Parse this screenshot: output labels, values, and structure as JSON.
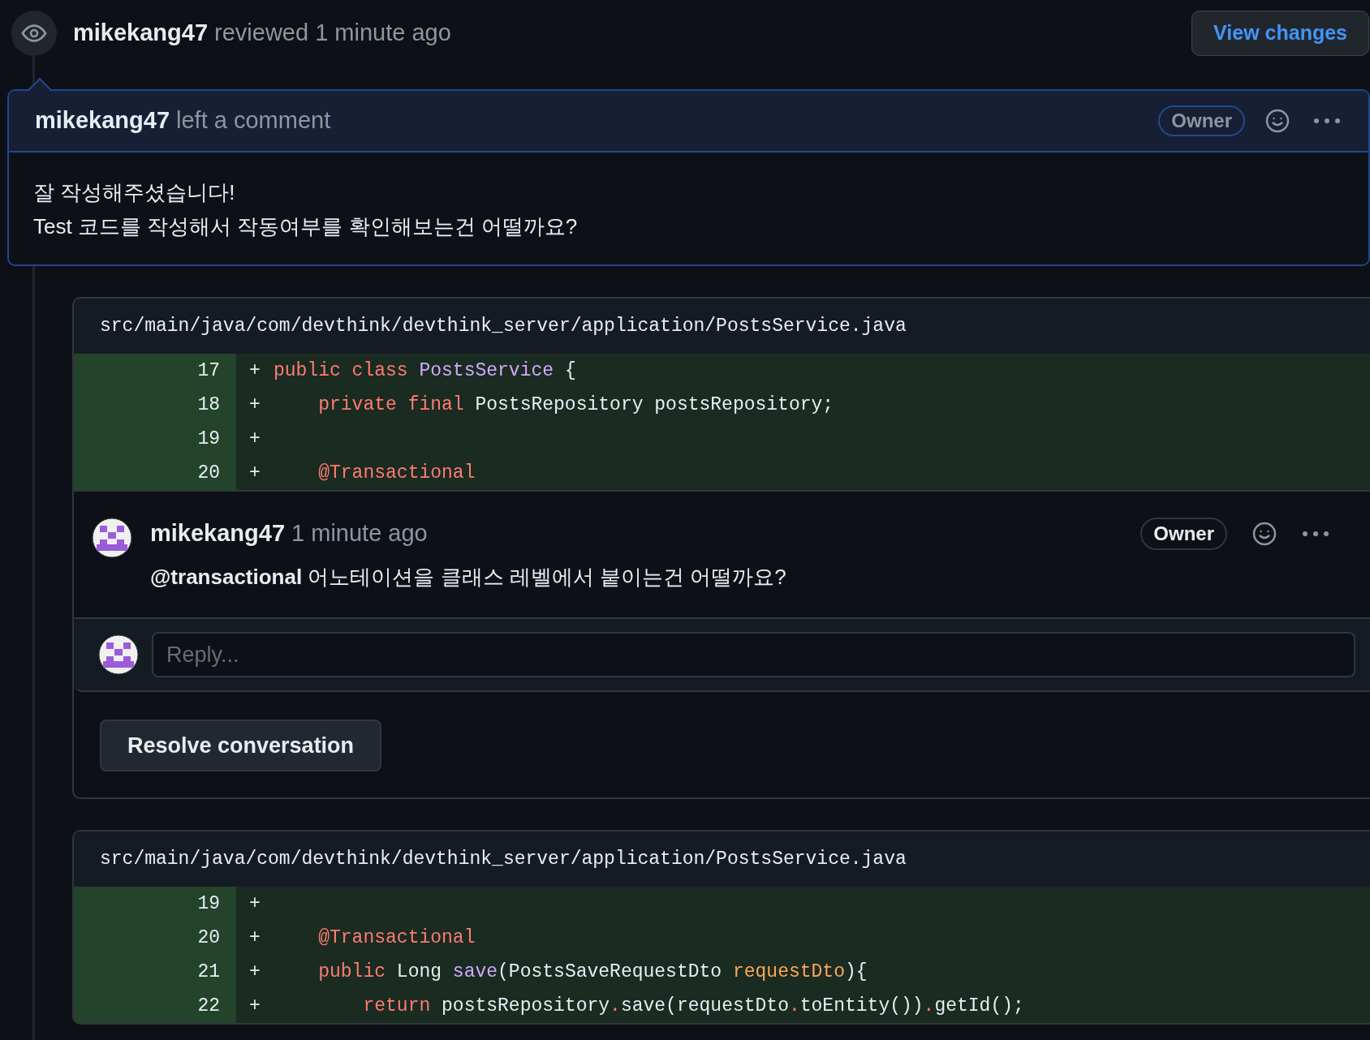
{
  "review": {
    "author": "mikekang47",
    "action": "reviewed 1 minute ago",
    "button": "View changes"
  },
  "comment": {
    "author": "mikekang47",
    "action": "left a comment",
    "badge": "Owner",
    "lines": [
      "잘 작성해주셨습니다!",
      "Test 코드를 작성해서 작동여부를 확인해보는건 어떨까요?"
    ]
  },
  "threads": [
    {
      "file": "src/main/java/com/devthink/devthink_server/application/PostsService.java",
      "lines": [
        {
          "number": "17",
          "sign": "+",
          "tokens": [
            {
              "kind": "keyword",
              "text": "public class "
            },
            {
              "kind": "type",
              "text": "PostsService"
            },
            {
              "kind": "plain",
              "text": " {"
            }
          ]
        },
        {
          "number": "18",
          "sign": "+",
          "tokens": [
            {
              "kind": "keyword",
              "text": "    private final "
            },
            {
              "kind": "plain",
              "text": "PostsRepository postsRepository;"
            }
          ]
        },
        {
          "number": "19",
          "sign": "+"
        },
        {
          "number": "20",
          "sign": "+",
          "tokens": [
            {
              "kind": "keyword",
              "text": "    @Transactional"
            }
          ]
        }
      ],
      "reply": {
        "author": "mikekang47",
        "time": "1 minute ago",
        "badge": "Owner",
        "body": "**@transactional** 어노테이션을 클래스 레벨에서 붙이는건 어떨까요?",
        "placeholder": "Reply...",
        "resolve": "Resolve conversation"
      }
    },
    {
      "file": "src/main/java/com/devthink/devthink_server/application/PostsService.java",
      "lines": [
        {
          "number": "19",
          "sign": "+"
        },
        {
          "number": "20",
          "sign": "+",
          "tokens": [
            {
              "kind": "keyword",
              "text": "    @Transactional"
            }
          ]
        },
        {
          "number": "21",
          "sign": "+",
          "tokens": [
            {
              "kind": "keyword",
              "text": "    public "
            },
            {
              "kind": "plain",
              "text": "Long "
            },
            {
              "kind": "type",
              "text": "save"
            },
            {
              "kind": "plain",
              "text": "(PostsSaveRequestDto "
            },
            {
              "kind": "param",
              "text": "requestDto"
            },
            {
              "kind": "plain",
              "text": "){"
            }
          ]
        },
        {
          "number": "22",
          "sign": "+",
          "tokens": [
            {
              "kind": "keyword",
              "text": "        return "
            },
            {
              "kind": "plain",
              "text": "postsRepository"
            },
            {
              "kind": "keyword",
              "text": "."
            },
            {
              "kind": "plain",
              "text": "save(requestDto"
            },
            {
              "kind": "keyword",
              "text": "."
            },
            {
              "kind": "plain",
              "text": "toEntity())"
            },
            {
              "kind": "keyword",
              "text": "."
            },
            {
              "kind": "plain",
              "text": "getId();"
            }
          ]
        }
      ]
    }
  ]
}
